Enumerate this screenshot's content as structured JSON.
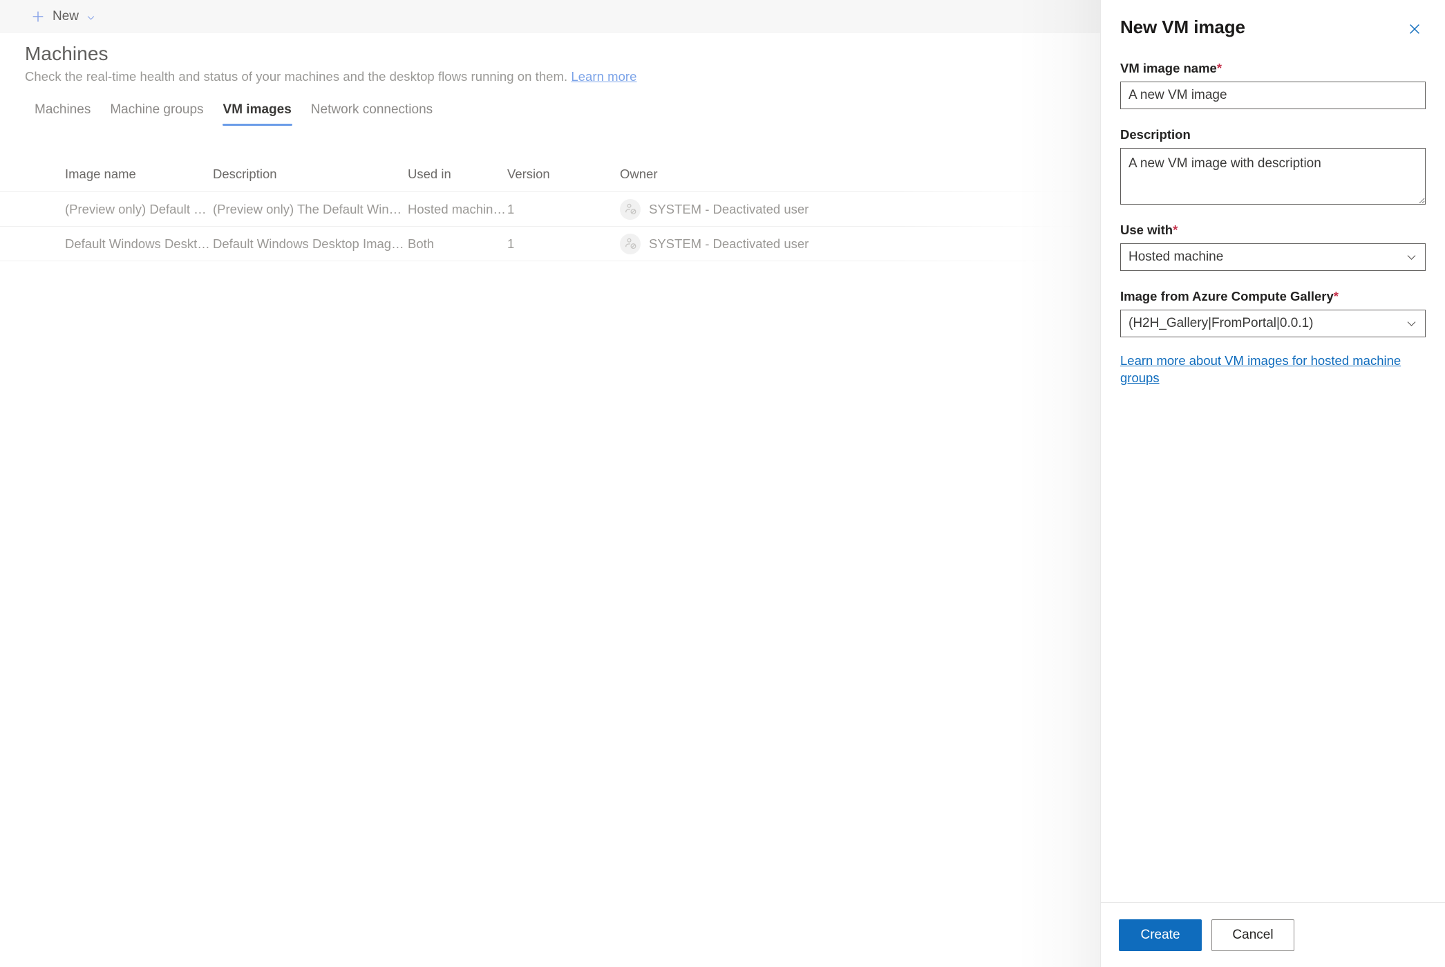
{
  "commandbar": {
    "new_label": "New",
    "plus_icon": "plus-icon",
    "chevron_icon": "chevron-down-icon"
  },
  "header": {
    "title": "Machines",
    "subtitle": "Check the real-time health and status of your machines and the desktop flows running on them.",
    "learn_more": "Learn more"
  },
  "tabs": [
    {
      "label": "Machines",
      "active": false
    },
    {
      "label": "Machine groups",
      "active": false
    },
    {
      "label": "VM images",
      "active": true
    },
    {
      "label": "Network connections",
      "active": false
    }
  ],
  "table": {
    "columns": [
      "Image name",
      "Description",
      "Used in",
      "Version",
      "Owner"
    ],
    "rows": [
      {
        "name": "(Preview only) Default Windo...",
        "description": "(Preview only) The Default Windows Desk...",
        "used_in": "Hosted machine group",
        "version": "1",
        "owner": "SYSTEM - Deactivated user",
        "owner_icon": "deactivated-user-icon"
      },
      {
        "name": "Default Windows Desktop I...",
        "description": "Default Windows Desktop Image for use i...",
        "used_in": "Both",
        "version": "1",
        "owner": "SYSTEM - Deactivated user",
        "owner_icon": "deactivated-user-icon"
      }
    ]
  },
  "panel": {
    "title": "New VM image",
    "close_icon": "close-icon",
    "fields": {
      "vm_image_name": {
        "label": "VM image name",
        "required": "*",
        "value": "A new VM image"
      },
      "description": {
        "label": "Description",
        "value": "A new VM image with description"
      },
      "use_with": {
        "label": "Use with",
        "required": "*",
        "value": "Hosted machine",
        "chevron_icon": "chevron-down-icon"
      },
      "gallery_image": {
        "label": "Image from Azure Compute Gallery",
        "required": "*",
        "value": "(H2H_Gallery|FromPortal|0.0.1)",
        "chevron_icon": "chevron-down-icon"
      }
    },
    "learn_link": "Learn more about VM images for hosted machine groups",
    "create_label": "Create",
    "cancel_label": "Cancel"
  },
  "colors": {
    "accent_blue": "#0f6cbd",
    "tab_underline": "#6b9ce8",
    "required_red": "#c4314b",
    "command_icon": "#8aa4e8"
  }
}
